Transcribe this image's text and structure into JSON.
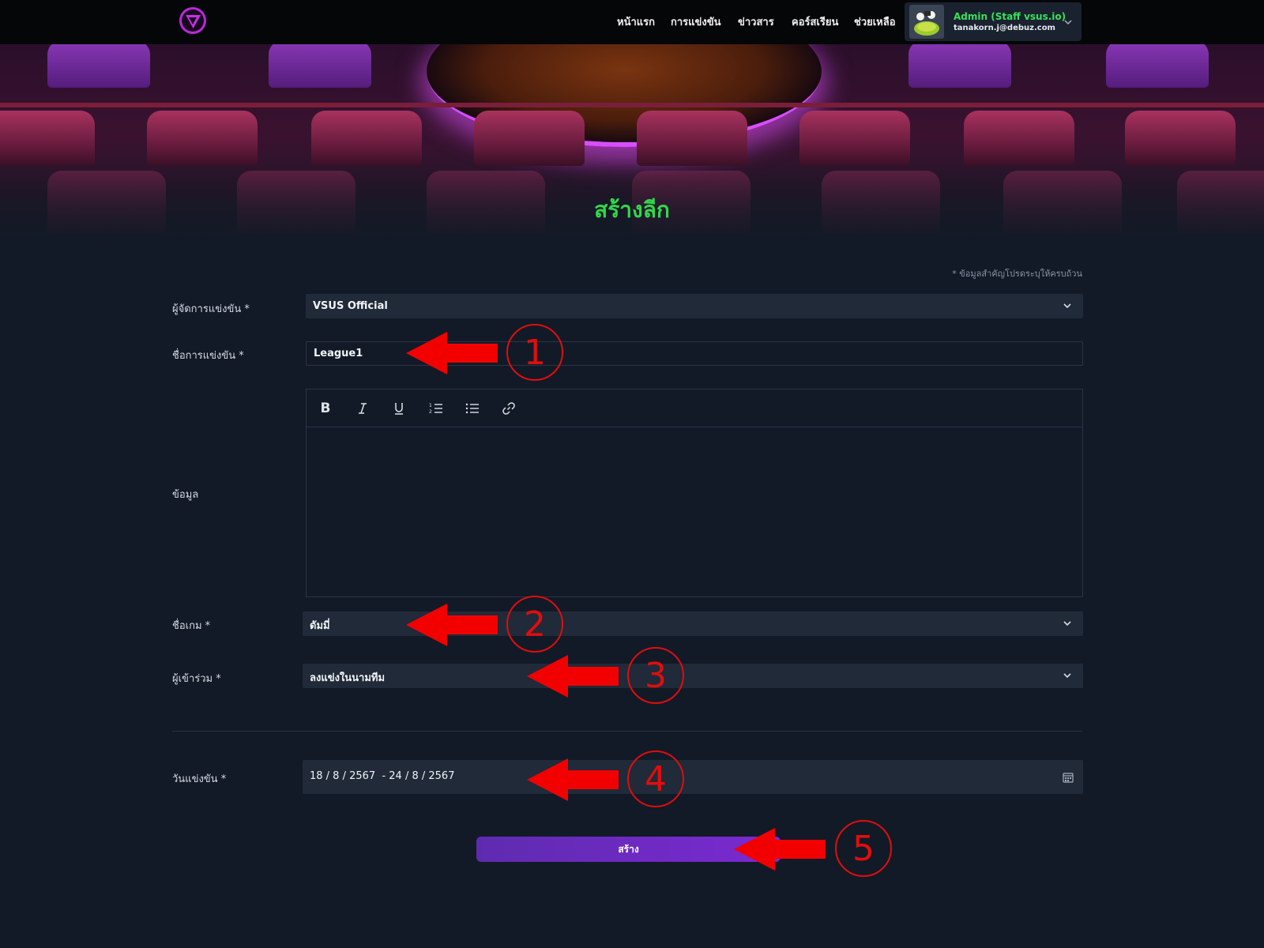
{
  "nav": {
    "items": [
      "หน้าแรก",
      "การแข่งขัน",
      "ข่าวสาร",
      "คอร์สเรียน",
      "ช่วยเหลือ"
    ]
  },
  "user": {
    "name": "Admin (Staff vsus.io)",
    "email": "tanakorn.j@debuz.com"
  },
  "page": {
    "title": "สร้างลีก",
    "required_note": "* ข้อมูลสำคัญโปรดระบุให้ครบถ้วน"
  },
  "form": {
    "organizer": {
      "label": "ผู้จัดการแข่งขัน *",
      "value": "VSUS Official"
    },
    "competition_name": {
      "label": "ชื่อการแข่งขัน *",
      "value": "League1"
    },
    "info": {
      "label": "ข้อมูล"
    },
    "game": {
      "label": "ชื่อเกม *",
      "value": "ดัมมี่"
    },
    "participants": {
      "label": "ผู้เข้าร่วม *",
      "value": "ลงแข่งในนามทีม"
    },
    "date": {
      "label": "วันแข่งขัน *",
      "value": "18 / 8 / 2567  - 24 / 8 / 2567"
    },
    "submit_label": "สร้าง"
  },
  "editor_toolbar": [
    "bold-icon",
    "italic-icon",
    "underline-icon",
    "ordered-list-icon",
    "bullet-list-icon",
    "link-icon"
  ],
  "annotations": [
    "1",
    "2",
    "3",
    "4",
    "5"
  ],
  "colors": {
    "accent_green": "#2fd94a",
    "button_purple": "#7b2ad0",
    "annotation_red": "#e10d0d",
    "background": "#121a27",
    "field": "#202a38"
  }
}
